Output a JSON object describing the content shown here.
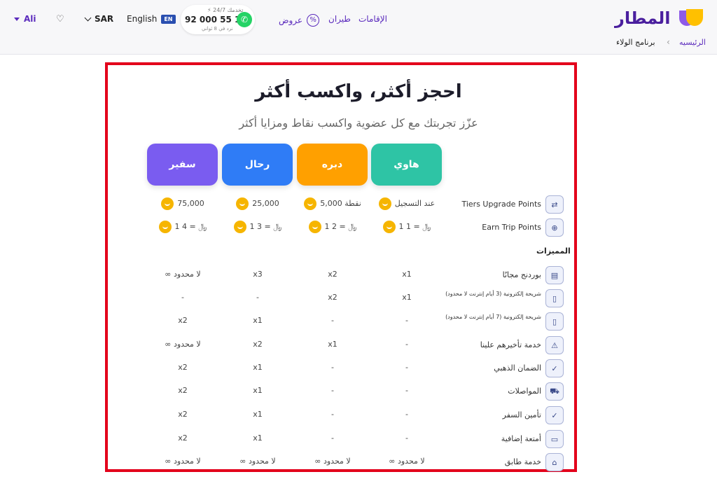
{
  "header": {
    "user_name": "Ali",
    "currency": "SAR",
    "language": "English",
    "language_badge": "EN",
    "support_top": "⚡ تخدمك 24/7",
    "phone": "92 000 55 11",
    "support_sub": "نرد في 8 ثواني",
    "nav": {
      "offers": "عروض",
      "flights": "طيران",
      "stays": "الإقامات"
    },
    "logo_text": "المطار",
    "colors": {
      "brand_purple": "#5b2bbd",
      "brand_yellow": "#ffc000",
      "whatsapp": "#25d366"
    }
  },
  "breadcrumb": {
    "home": "الرئيسيه",
    "separator": "‹",
    "current": "برنامج الولاء"
  },
  "hero": {
    "title": "احجز أكثر، واكسب أكثر",
    "subtitle": "عزّز تجربتك مع كل عضوية واكسب نقاط ومزايا أكثر"
  },
  "tiers": [
    {
      "name": "هاوي",
      "color": "#2ec4a5"
    },
    {
      "name": "دبره",
      "color": "#ffa000"
    },
    {
      "name": "رحال",
      "color": "#2f7cf6"
    },
    {
      "name": "سفير",
      "color": "#7a5cf0"
    }
  ],
  "points_rows": [
    {
      "label": "Tiers Upgrade Points",
      "icon": "points-badge-icon",
      "values": [
        "عند التسجيل",
        "5,000 نقطة",
        "25,000",
        "75,000"
      ]
    },
    {
      "label": "Earn Trip Points",
      "icon": "plus-circle-icon",
      "values": [
        "1 ﷼ = 1",
        "1 ﷼ = 2",
        "1 ﷼ = 3",
        "1 ﷼ = 4"
      ]
    }
  ],
  "features_title": "المميزات",
  "features": [
    {
      "label": "بوردنج مجانًا",
      "icon": "boarding-pass-icon",
      "values": [
        "x1",
        "x2",
        "x3",
        "∞ لا محدود"
      ]
    },
    {
      "label": "شريحة إلكترونية (3 أيام إنترنت لا محدود)",
      "icon": "sim-card-icon",
      "values": [
        "x1",
        "x2",
        "-",
        "-"
      ]
    },
    {
      "label": "شريحة إلكترونية (7 أيام إنترنت لا محدود)",
      "icon": "sim-card-icon",
      "values": [
        "-",
        "-",
        "x1",
        "x2"
      ]
    },
    {
      "label": "خدمة تأخيرهم علينا",
      "icon": "warning-icon",
      "values": [
        "-",
        "x1",
        "x2",
        "∞ لا محدود"
      ]
    },
    {
      "label": "الضمان الذهبي",
      "icon": "shield-check-icon",
      "values": [
        "-",
        "-",
        "x1",
        "x2"
      ]
    },
    {
      "label": "المواصلات",
      "icon": "car-icon",
      "values": [
        "-",
        "-",
        "x1",
        "x2"
      ]
    },
    {
      "label": "تأمين السفر",
      "icon": "shield-check-icon",
      "values": [
        "-",
        "-",
        "x1",
        "x2"
      ]
    },
    {
      "label": "أمتعة إضافية",
      "icon": "luggage-icon",
      "values": [
        "-",
        "-",
        "x1",
        "x2"
      ]
    },
    {
      "label": "خدمة طابق",
      "icon": "lounge-icon",
      "values": [
        "∞ لا محدود",
        "∞ لا محدود",
        "∞ لا محدود",
        "∞ لا محدود"
      ]
    }
  ]
}
